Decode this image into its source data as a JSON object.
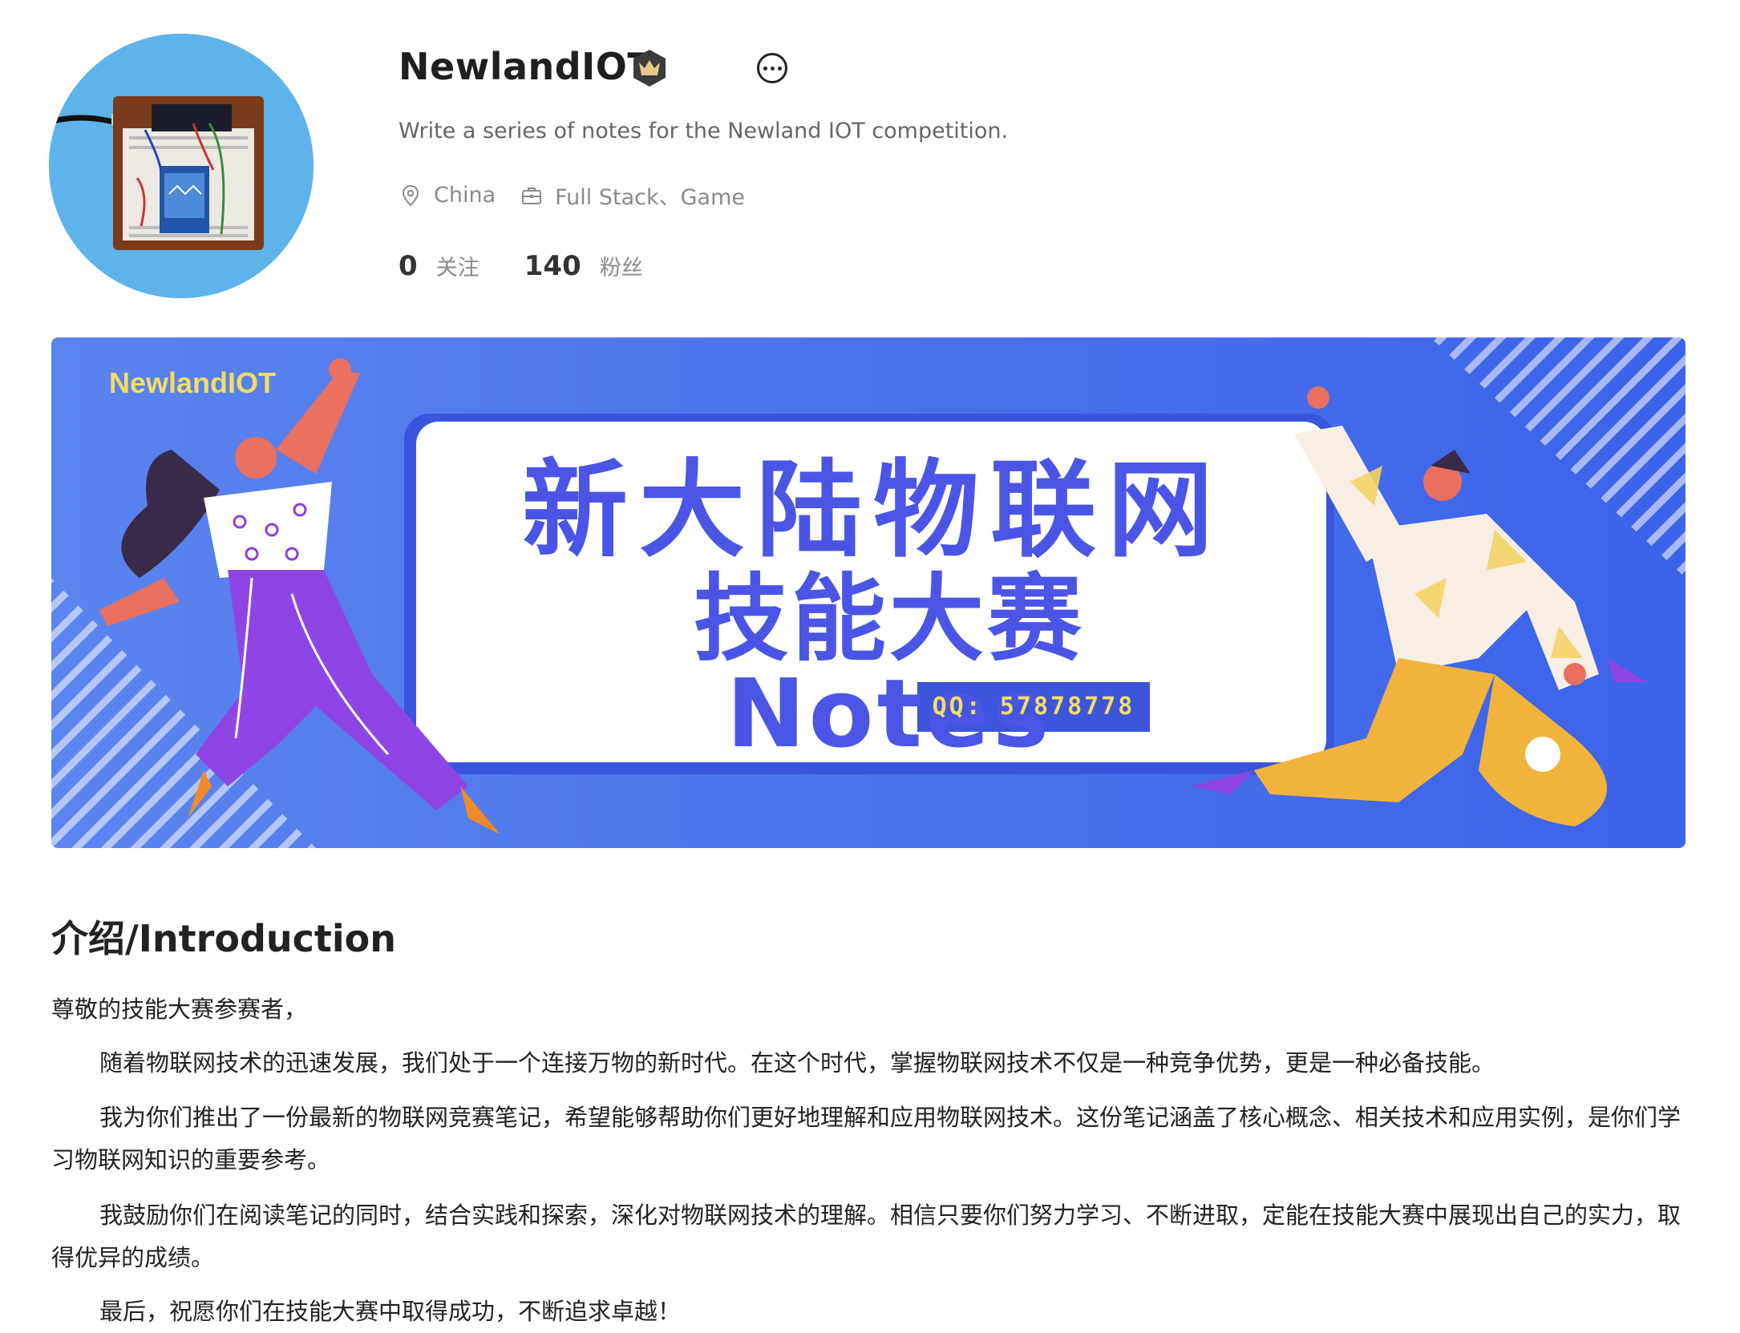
{
  "profile": {
    "name": "NewlandIOT",
    "bio": "Write a series of notes for the Newland IOT competition.",
    "location": "China",
    "occupation": "Full Stack、Game",
    "following_count": "0",
    "following_label": "关注",
    "followers_count": "140",
    "followers_label": "粉丝"
  },
  "banner": {
    "brand": "NewlandIOT",
    "title_line1": "新大陆物联网",
    "title_line2": "技能大赛Notes",
    "qq": "QQ: 57878778"
  },
  "intro": {
    "heading": "介绍/Introduction",
    "greeting": "尊敬的技能大赛参赛者，",
    "p1": "随着物联网技术的迅速发展，我们处于一个连接万物的新时代。在这个时代，掌握物联网技术不仅是一种竞争优势，更是一种必备技能。",
    "p2": "我为你们推出了一份最新的物联网竞赛笔记，希望能够帮助你们更好地理解和应用物联网技术。这份笔记涵盖了核心概念、相关技术和应用实例，是你们学习物联网知识的重要参考。",
    "p3": "我鼓励你们在阅读笔记的同时，结合实践和探索，深化对物联网技术的理解。相信只要你们努力学习、不断进取，定能在技能大赛中展现出自己的实力，取得优异的成绩。",
    "p4": "最后，祝愿你们在技能大赛中取得成功，不断追求卓越！"
  },
  "colors": {
    "banner_blue": "#4a73ef",
    "banner_text": "#4a55e6",
    "brand_yellow": "#f3dd62",
    "avatar_bg": "#5db3ea"
  }
}
